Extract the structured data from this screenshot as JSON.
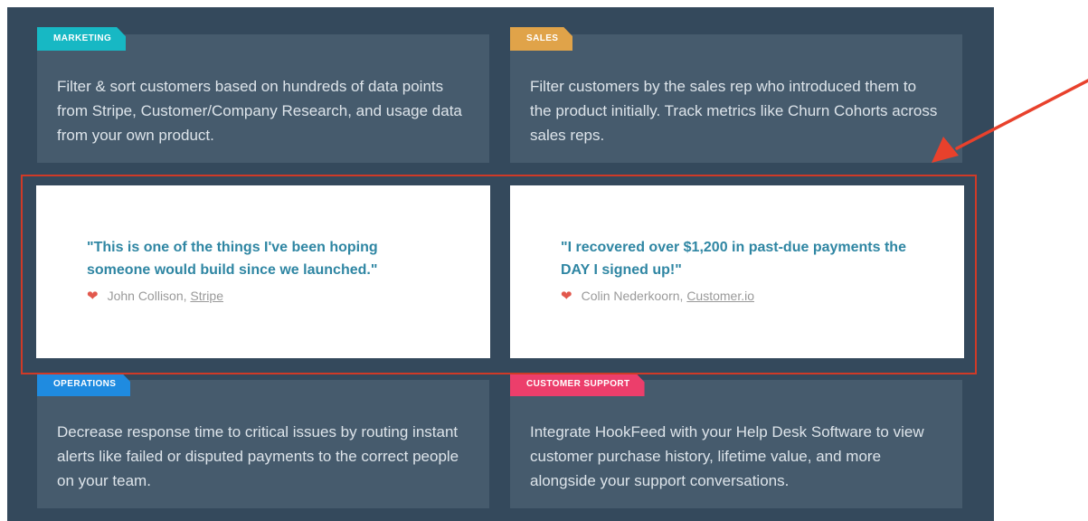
{
  "cards": {
    "marketing": {
      "tag": "MARKETING",
      "tag_color": "#17b8c4",
      "text": "Filter & sort customers based on hundreds of data points from Stripe, Customer/Company Research, and usage data from your own product."
    },
    "sales": {
      "tag": "SALES",
      "tag_color": "#e0a349",
      "text": "Filter customers by the sales rep who introduced them to the product initially. Track metrics like Churn Cohorts across sales reps."
    },
    "operations": {
      "tag": "OPERATIONS",
      "tag_color": "#1f8be0",
      "text": "Decrease response time to critical issues by routing instant alerts like failed or disputed payments to the correct people on your team."
    },
    "support": {
      "tag": "CUSTOMER SUPPORT",
      "tag_color": "#ec3e6b",
      "text": "Integrate HookFeed with your Help Desk Software to view customer purchase history, lifetime value, and more alongside your support conversations."
    }
  },
  "testimonials": [
    {
      "quote": "\"This is one of the things I've been hoping someone would build since we launched.\"",
      "author": "John Collison, ",
      "company": "Stripe"
    },
    {
      "quote": "\"I recovered over $1,200 in past-due payments the DAY I signed up!\"",
      "author": "Colin Nederkoorn, ",
      "company": "Customer.io"
    }
  ],
  "icons": {
    "heart": "heart-icon",
    "arrow": "red-arrow-annotation"
  },
  "colors": {
    "panel": "#34495c",
    "card": "#465b6d",
    "quote": "#2f86a3",
    "highlight": "#d03a27"
  }
}
